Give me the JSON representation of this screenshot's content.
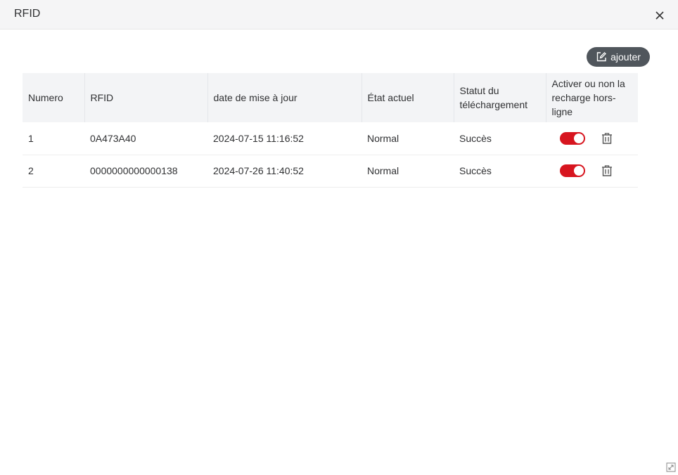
{
  "dialog": {
    "title": "RFID",
    "close_icon": "close-icon"
  },
  "toolbar": {
    "add_label": "ajouter",
    "add_icon": "edit-square-icon"
  },
  "table": {
    "columns": [
      "Numero",
      "RFID",
      "date de mise à jour",
      "État actuel",
      "Statut du téléchargement",
      "Activer ou non la recharge hors-ligne"
    ],
    "rows": [
      {
        "numero": "1",
        "rfid": "0A473A40",
        "date": "2024-07-15 11:16:52",
        "etat": "Normal",
        "statut": "Succès",
        "offline_enabled": true
      },
      {
        "numero": "2",
        "rfid": "0000000000000138",
        "date": "2024-07-26 11:40:52",
        "etat": "Normal",
        "statut": "Succès",
        "offline_enabled": true
      }
    ]
  },
  "colors": {
    "accent": "#d7151f",
    "button_bg": "#50565c",
    "header_bg": "#f3f4f6"
  }
}
